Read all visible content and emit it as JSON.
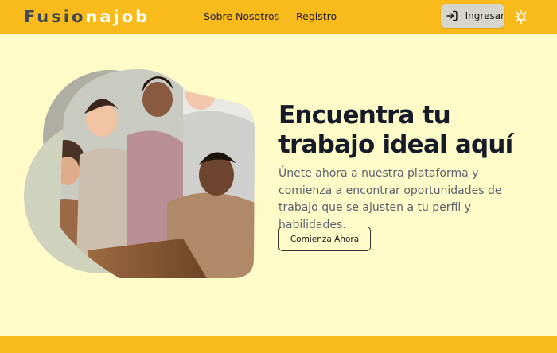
{
  "brand": {
    "part1": "Fusio",
    "part2": "najob"
  },
  "nav": {
    "about": "Sobre Nosotros",
    "register": "Registro"
  },
  "header_actions": {
    "login_label": "Ingresar",
    "login_icon": "login-icon",
    "theme_icon": "theme-toggle-icon"
  },
  "hero": {
    "headline_line1": "Encuentra tu",
    "headline_line2": "trabajo ideal aquí",
    "description": "Únete ahora a nuestra plataforma y comienza a encontrar oportunidades de trabajo que se ajusten a tu perfil y habilidades.",
    "cta_label": "Comienza Ahora",
    "image": "group-of-people-working-photo"
  },
  "colors": {
    "header": "#f9bb1c",
    "background": "#fefbc8",
    "logo_dark": "#3f4a55",
    "logo_light": "#ffffff",
    "headline": "#161b2a",
    "text_muted": "#5c6270"
  }
}
